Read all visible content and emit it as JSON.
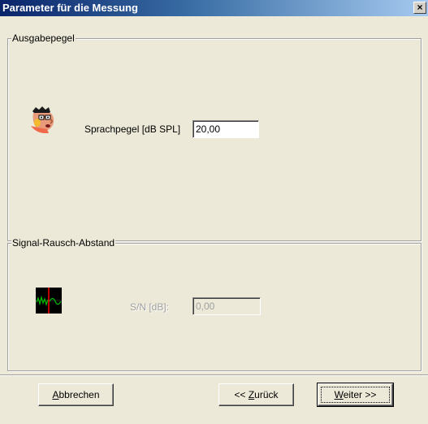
{
  "window": {
    "title": "Parameter für die Messung",
    "close_glyph": "×"
  },
  "output_level_group": {
    "legend": "Ausgabepegel",
    "icon": "speaking-face-icon",
    "field_label": "Sprachpegel [dB SPL]",
    "field_value": "20,00"
  },
  "snr_group": {
    "legend": "Signal-Rausch-Abstand",
    "icon": "signal-scope-icon",
    "field_label": "S/N [dB]:",
    "field_value": "0,00",
    "enabled": false
  },
  "buttons": {
    "cancel": {
      "pre": "",
      "accel": "A",
      "post": "bbrechen"
    },
    "back": {
      "pre": "<< ",
      "accel": "Z",
      "post": "urück"
    },
    "next": {
      "pre": "",
      "accel": "W",
      "post": "eiter >>"
    }
  },
  "colors": {
    "title_start": "#0a246a",
    "title_end": "#a6caf0",
    "face": "#ece9d8",
    "scope_bg": "#000000",
    "scope_wave": "#00c000",
    "scope_cursor": "#ff0000"
  }
}
